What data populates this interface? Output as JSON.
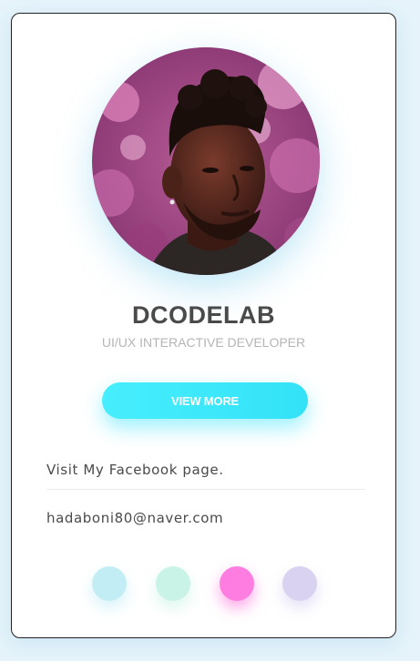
{
  "profile": {
    "name": "DCODELAB",
    "role": "UI/UX INTERACTIVE DEVELOPER",
    "photo_alt": "profile photo"
  },
  "actions": {
    "view_more_label": "VIEW MORE"
  },
  "links": {
    "facebook_text": "Visit My Facebook page.",
    "email_text": "hadaboni80@naver.com"
  },
  "color_dots": [
    {
      "name": "cyan",
      "color": "#c3edf5"
    },
    {
      "name": "mint",
      "color": "#c9f3e6"
    },
    {
      "name": "pink",
      "color": "#fd7ee0"
    },
    {
      "name": "lavender",
      "color": "#d9d2f1"
    }
  ],
  "theme": {
    "accent": "#3ae8fa",
    "text": "#4a4a4a",
    "muted": "#b5b5b5",
    "background": "#e6f3fa"
  }
}
